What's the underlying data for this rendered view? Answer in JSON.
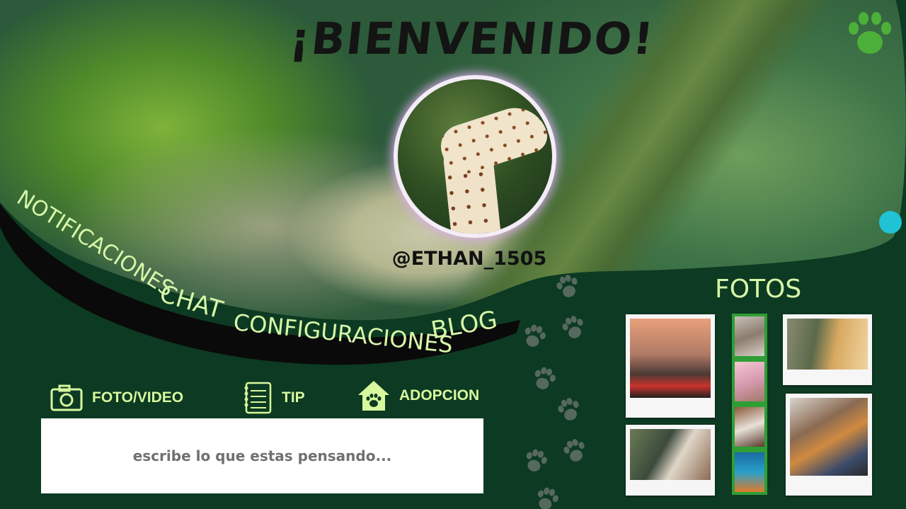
{
  "header": {
    "title": "¡BIENVENIDO!"
  },
  "profile": {
    "username": "@ETHAN_1505"
  },
  "nav": {
    "items": [
      {
        "label": "NOTIFICACIONES"
      },
      {
        "label": "CHAT"
      },
      {
        "label": "CONFIGURACIONES"
      },
      {
        "label": "BLOG"
      }
    ]
  },
  "gallery": {
    "title": "FOTOS"
  },
  "actions": {
    "photo_video": "FOTO/VIDEO",
    "tip": "TIP",
    "adopcion": "ADOPCION"
  },
  "post": {
    "placeholder": "escribe lo que estas pensando..."
  },
  "colors": {
    "background": "#0d3a22",
    "accent_text": "#d8f89e",
    "paw_green": "#4caf3a",
    "dot_cyan": "#1fc3d3",
    "avatar_glow": "#dcaaf0"
  }
}
